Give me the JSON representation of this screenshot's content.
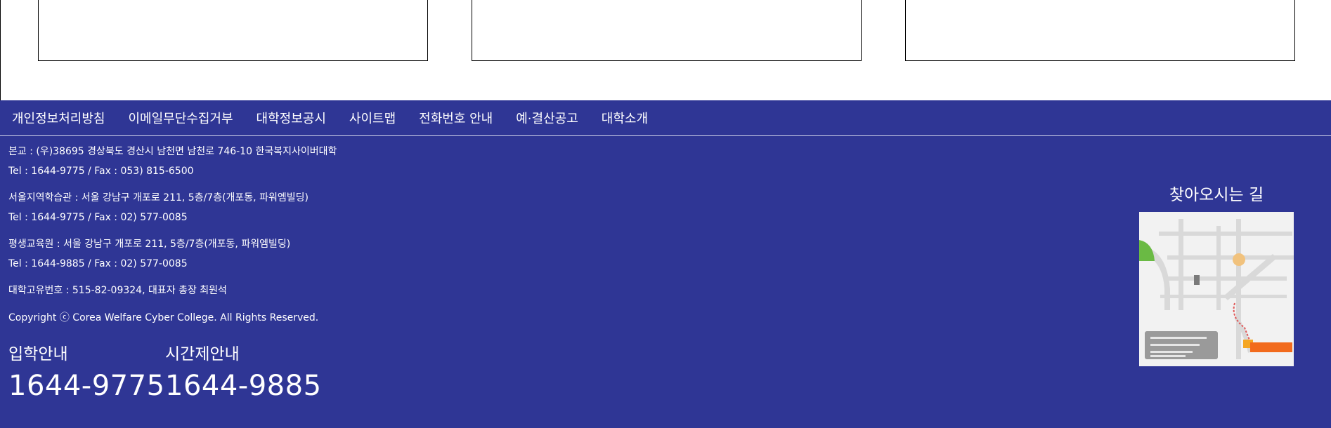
{
  "footer": {
    "nav": [
      {
        "label": "개인정보처리방침"
      },
      {
        "label": "이메일무단수집거부"
      },
      {
        "label": "대학정보공시"
      },
      {
        "label": "사이트맵"
      },
      {
        "label": "전화번호 안내"
      },
      {
        "label": "예·결산공고"
      },
      {
        "label": "대학소개"
      }
    ],
    "info": [
      "본교 : (우)38695 경상북도 경산시 남천면 남천로 746-10 한국복지사이버대학",
      "Tel : 1644-9775 / Fax : 053) 815-6500",
      "서울지역학습관 : 서울 강남구 개포로 211, 5층/7층(개포동, 파워엠빌딩)",
      "Tel : 1644-9775 / Fax : 02) 577-0085",
      "평생교육원 : 서울 강남구 개포로 211, 5층/7층(개포동, 파워엠빌딩)",
      "Tel : 1644-9885 / Fax : 02) 577-0085",
      "대학고유번호 : 515-82-09324, 대표자 총장 최원석",
      "Copyright ⓒ Corea Welfare Cyber College. All Rights Reserved."
    ],
    "phones": [
      {
        "label": "입학안내",
        "number": "1644-9775"
      },
      {
        "label": "시간제안내",
        "number": "1644-9885"
      }
    ],
    "directions": {
      "title": "찾아오시는 길"
    }
  }
}
